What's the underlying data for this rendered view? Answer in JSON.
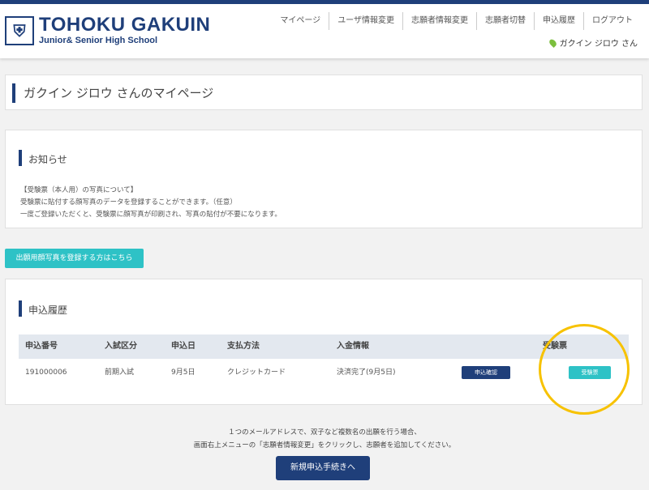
{
  "header": {
    "logo_main": "TOHOKU GAKUIN",
    "logo_sub": "Junior& Senior High School",
    "nav": [
      "マイページ",
      "ユーザ情報変更",
      "志願者情報変更",
      "志願者切替",
      "申込履歴",
      "ログアウト"
    ],
    "user_name": "ガクイン ジロウ さん"
  },
  "page_title": "ガクイン ジロウ さんのマイページ",
  "notice": {
    "title": "お知らせ",
    "lines": [
      "【受験票（本人用）の写真について】",
      "受験票に貼付する顔写真のデータを登録することができます。（任意）",
      "一度ご登録いただくと、受験票に顔写真が印刷され、写真の貼付が不要になります。"
    ]
  },
  "photo_button": "出願用顔写真を登録する方はこちら",
  "history": {
    "title": "申込履歴",
    "columns": [
      "申込番号",
      "入試区分",
      "申込日",
      "支払方法",
      "入金情報",
      "受験票"
    ],
    "rows": [
      {
        "number": "191000006",
        "category": "前期入試",
        "date": "9月5日",
        "payment": "クレジットカード",
        "status": "決済完了(9月5日)",
        "detail_button": "申込確認",
        "ticket_button": "受験票"
      }
    ]
  },
  "note_lines": [
    "１つのメールアドレスで、双子など複数名の出願を行う場合、",
    "画面右上メニューの「志願者情報変更」をクリックし、志願者を追加してください。"
  ],
  "new_button": "新規申込手続きへ",
  "colors": {
    "primary": "#1f3f7a",
    "accent": "#2ec2c6",
    "highlight": "#f7c200"
  }
}
